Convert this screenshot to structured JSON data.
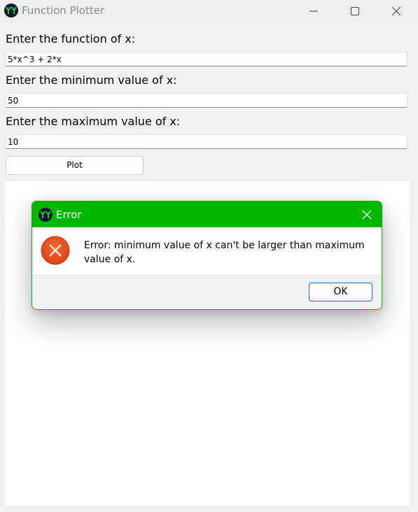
{
  "window": {
    "title": "Function Plotter",
    "logo_icon": "yy-logo-icon",
    "controls": [
      "minimize-icon",
      "maximize-icon",
      "close-icon"
    ]
  },
  "form": {
    "function_label": "Enter the function of x:",
    "function_value": "5*x^3 + 2*x",
    "min_label": "Enter the minimum value of x:",
    "min_value": "50",
    "max_label": "Enter the maximum value of x:",
    "max_value": "10",
    "plot_button": "Plot"
  },
  "error_dialog": {
    "title": "Error",
    "message": "Error: minimum value of x can't be larger than maximum value of x.",
    "ok_button": "OK",
    "icon": "error-icon",
    "accent_color": "#00b700",
    "error_color": "#e4491b"
  }
}
